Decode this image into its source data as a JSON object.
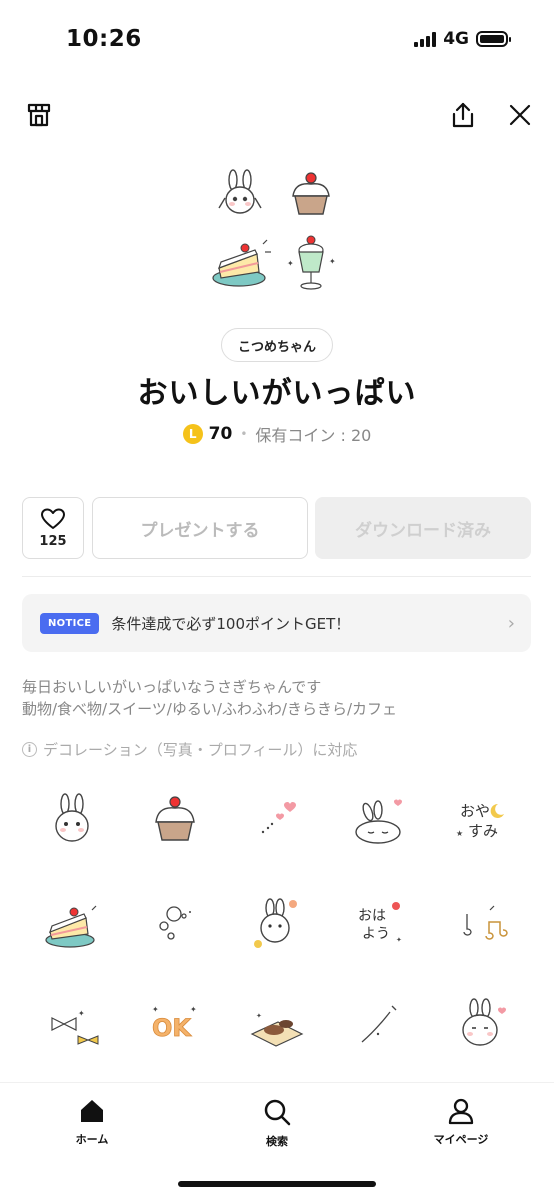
{
  "status_bar": {
    "time": "10:26",
    "network": "4G"
  },
  "header": {
    "shop_icon": "shop-icon",
    "share_icon": "share-icon",
    "close_icon": "close-icon"
  },
  "product": {
    "author": "こつめちゃん",
    "title": "おいしいがいっぱい",
    "coin_symbol": "L",
    "price": "70",
    "separator": "•",
    "owned_coins": "保有コイン : 20"
  },
  "actions": {
    "like_count": "125",
    "present_label": "プレゼントする",
    "download_label": "ダウンロード済み"
  },
  "notice": {
    "badge": "NOTICE",
    "text": "条件達成で必ず100ポイントGET！",
    "chevron": "›"
  },
  "description": {
    "line1": "毎日おいしいがいっぱいなうさぎちゃんです",
    "line2": "動物/食べ物/スイーツ/ゆるい/ふわふわ/きらきら/カフェ",
    "decoration_note": "デコレーション（写真・プロフィール）に対応",
    "info_symbol": "i"
  },
  "sticker_grid": [
    "bunny-face",
    "cupcake",
    "hearts",
    "sleeping-bunny",
    "oyasumi-text",
    "cake-slice",
    "bubbles",
    "bunny-flower",
    "ohayou-text",
    "music-notes",
    "ribbon-sparkle",
    "ok-text",
    "waffle-plate",
    "sparkle-line",
    "bunny-heart"
  ],
  "sticker_text": {
    "oyasumi_1": "おや",
    "oyasumi_2": "すみ",
    "ohayou_1": "おは",
    "ohayou_2": "よう",
    "ok": "OK"
  },
  "tabbar": {
    "home": "ホーム",
    "search": "検索",
    "mypage": "マイページ"
  },
  "colors": {
    "notice_badge": "#4a6cf0",
    "coin": "#f5c21a",
    "download_bg": "#eeeeee"
  }
}
